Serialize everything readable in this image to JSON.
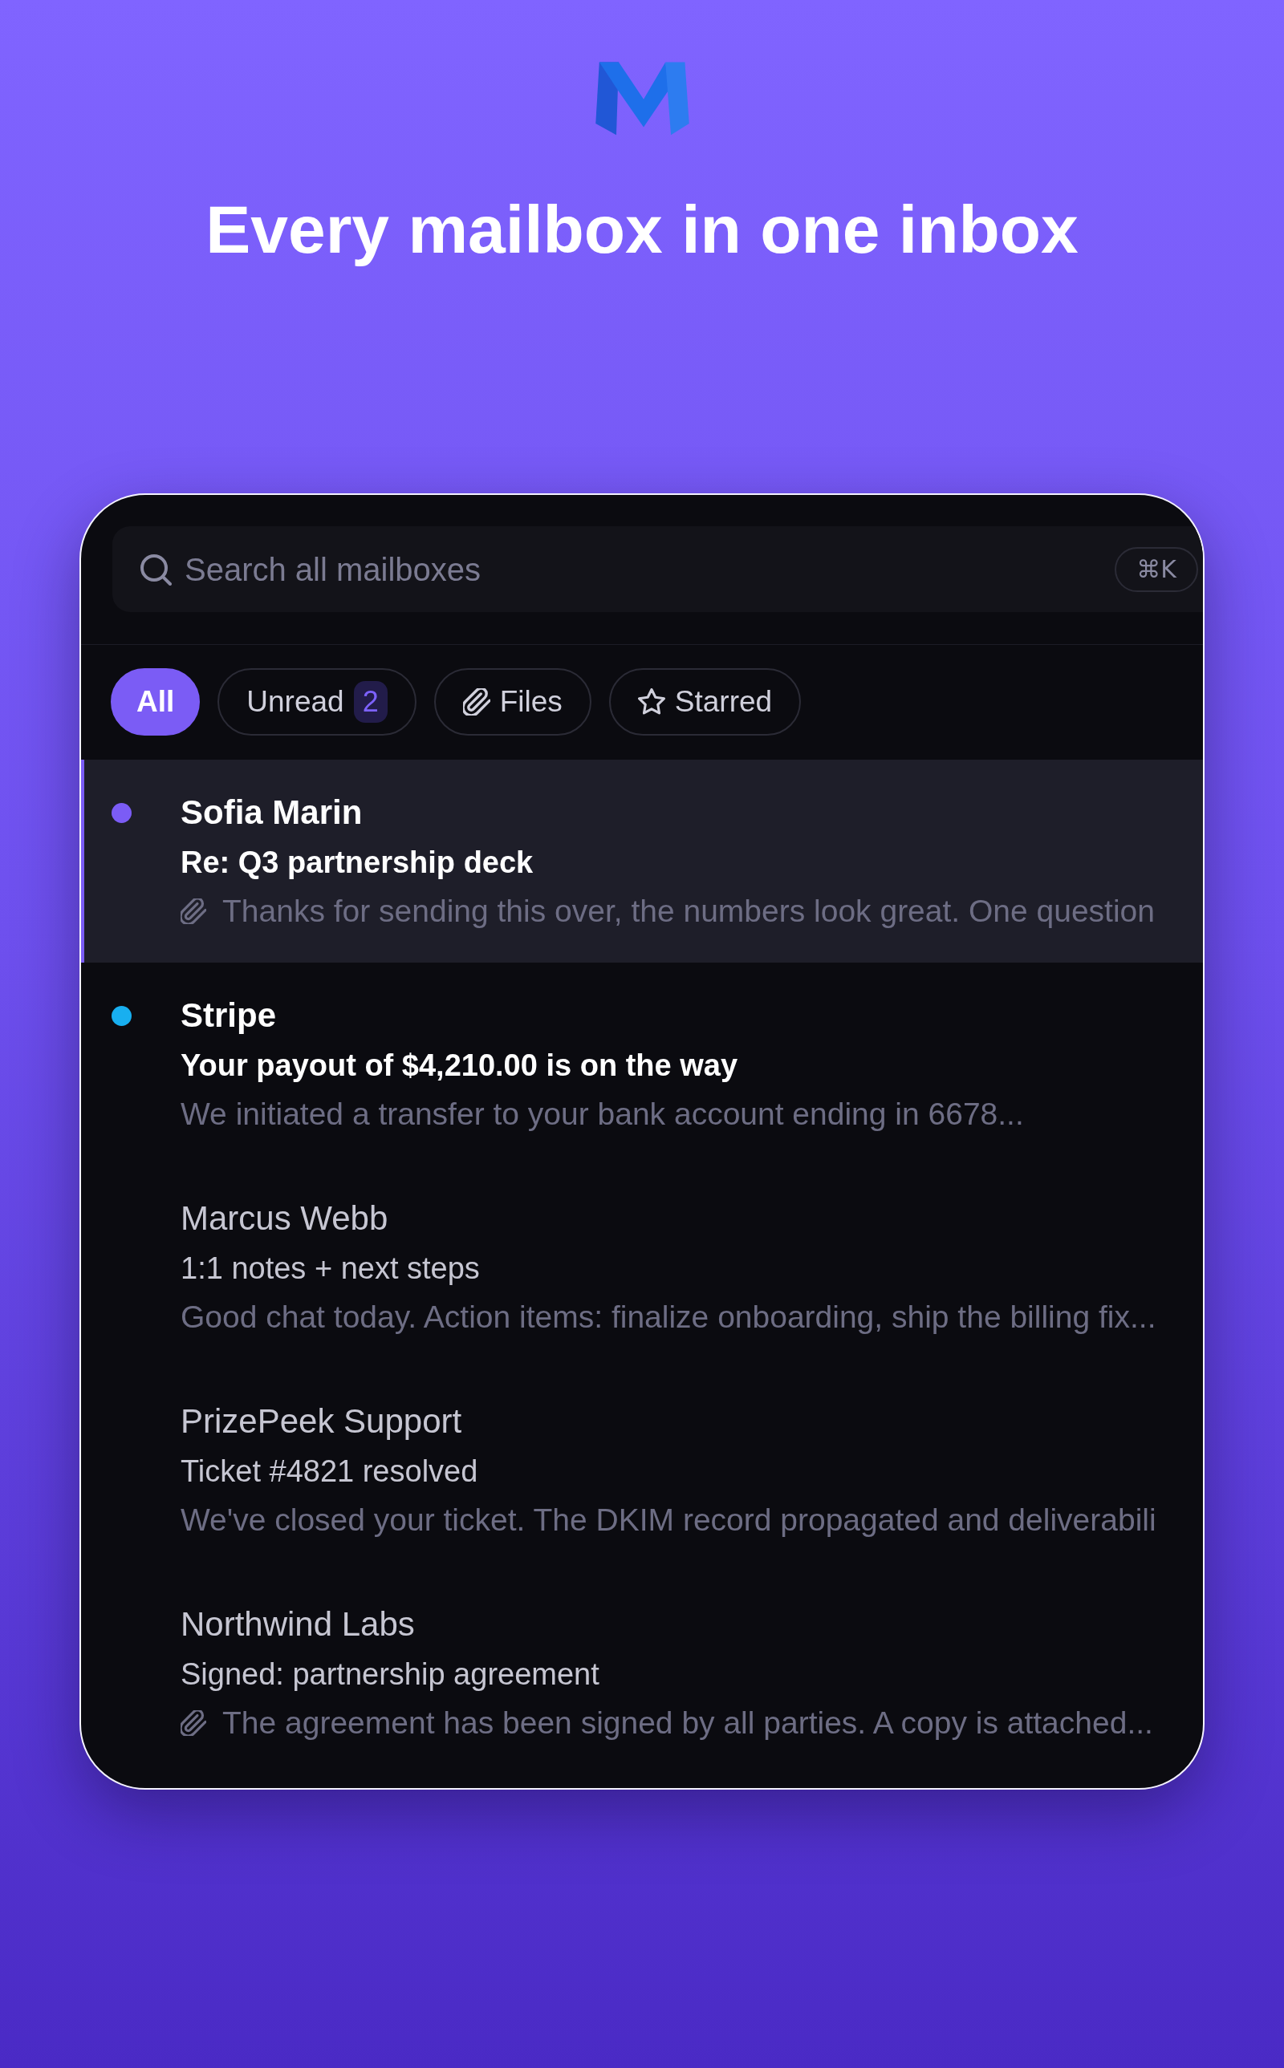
{
  "header": {
    "title": "Every mailbox in one inbox"
  },
  "search": {
    "placeholder": "Search all mailboxes",
    "shortcut": "⌘K"
  },
  "filters": [
    {
      "label": "All",
      "kind": "plain",
      "selected": true
    },
    {
      "label": "Unread",
      "kind": "count",
      "count": "2",
      "selected": false
    },
    {
      "label": "Files",
      "kind": "attachments",
      "selected": false
    },
    {
      "label": "Starred",
      "kind": "starred",
      "selected": false
    }
  ],
  "messages": [
    {
      "sender": "Sofia Marin",
      "subject": "Re: Q3 partnership deck",
      "preview": "Thanks for sending this over, the numbers look great. One question",
      "unread": true,
      "color": "#7b5cf5",
      "has_attachment": true,
      "selected": true
    },
    {
      "sender": "Stripe",
      "subject": "Your payout of $4,210.00 is on the way",
      "preview": "We initiated a transfer to your bank account ending in 6678...",
      "unread": true,
      "color": "#18aff0",
      "has_attachment": false,
      "selected": false
    },
    {
      "sender": "Marcus Webb",
      "subject": "1:1 notes + next steps",
      "preview": "Good chat today. Action items: finalize onboarding, ship the billing fix...",
      "unread": false,
      "has_attachment": false,
      "selected": false
    },
    {
      "sender": "PrizePeek Support",
      "subject": "Ticket #4821 resolved",
      "preview": "We've closed your ticket. The DKIM record propagated and deliverabili",
      "unread": false,
      "has_attachment": false,
      "selected": false
    },
    {
      "sender": "Northwind Labs",
      "subject": "Signed: partnership agreement",
      "preview": "The agreement has been signed by all parties. A copy is attached...",
      "unread": false,
      "has_attachment": true,
      "selected": false
    }
  ]
}
